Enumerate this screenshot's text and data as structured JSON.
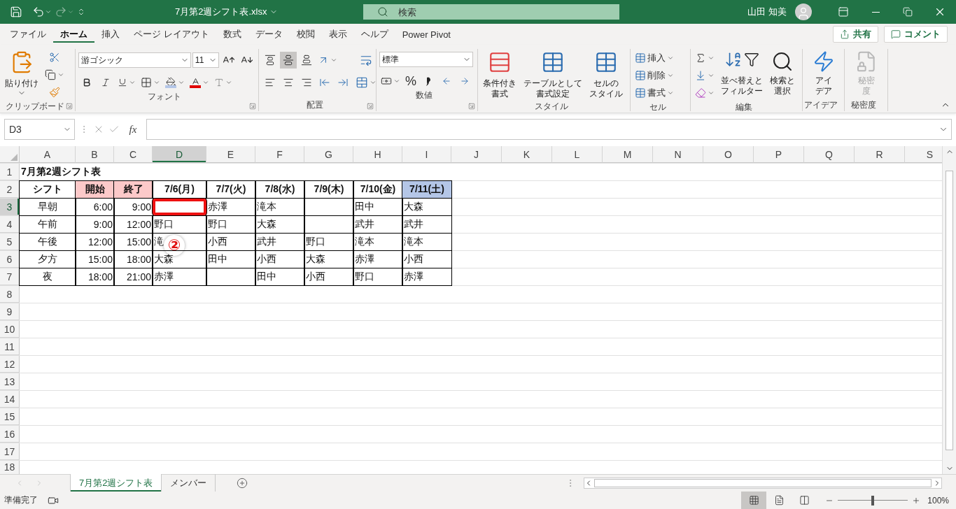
{
  "title_bar": {
    "file_name": "7月第2週シフト表.xlsx",
    "search": {
      "placeholder": "検索"
    },
    "user_name": "山田 知美"
  },
  "menu_tabs": [
    {
      "label": "ファイル",
      "selected": false
    },
    {
      "label": "ホーム",
      "selected": true
    },
    {
      "label": "挿入",
      "selected": false
    },
    {
      "label": "ページ レイアウト",
      "selected": false
    },
    {
      "label": "数式",
      "selected": false
    },
    {
      "label": "データ",
      "selected": false
    },
    {
      "label": "校閲",
      "selected": false
    },
    {
      "label": "表示",
      "selected": false
    },
    {
      "label": "ヘルプ",
      "selected": false
    },
    {
      "label": "Power Pivot",
      "selected": false
    }
  ],
  "share_button": "共有",
  "comment_button": "コメント",
  "ribbon": {
    "groups": [
      {
        "kind": "clipboard",
        "label": "クリップボード",
        "paste": "貼り付け"
      },
      {
        "kind": "font",
        "label": "フォント",
        "font_name": "游ゴシック",
        "font_size": "11"
      },
      {
        "kind": "alignment",
        "label": "配置",
        "vertical_buttons": [
          {
            "selected": false
          },
          {
            "selected": true
          },
          {
            "selected": false
          }
        ]
      },
      {
        "kind": "number",
        "label": "数値",
        "format": "標準",
        "percent": "%"
      },
      {
        "kind": "styles",
        "label": "スタイル",
        "buttons": [
          {
            "lines": [
              "条件付き",
              "書式"
            ]
          },
          {
            "lines": [
              "テーブルとして",
              "書式設定"
            ]
          },
          {
            "lines": [
              "セルの",
              "スタイル"
            ]
          }
        ]
      },
      {
        "kind": "cells",
        "label": "セル",
        "buttons": [
          "挿入",
          "削除",
          "書式"
        ]
      },
      {
        "kind": "editing",
        "label": "編集",
        "buttons": [
          {
            "lines": [
              "並べ替えと",
              "フィルター"
            ]
          },
          {
            "lines": [
              "検索と",
              "選択"
            ]
          }
        ]
      },
      {
        "kind": "ideas",
        "label": "アイデア",
        "button": {
          "lines": [
            "アイ",
            "デア"
          ],
          "disabled": false
        }
      },
      {
        "kind": "sensitivity",
        "label": "秘密度",
        "button": {
          "lines": [
            "秘密",
            "度"
          ],
          "disabled": true
        }
      }
    ]
  },
  "formula_bar": {
    "name_box": "D3",
    "function_label": "fx"
  },
  "sheet": {
    "columns": [
      {
        "label": "A",
        "selected": false
      },
      {
        "label": "B",
        "selected": false
      },
      {
        "label": "C",
        "selected": false
      },
      {
        "label": "D",
        "selected": true
      },
      {
        "label": "E",
        "selected": false
      },
      {
        "label": "F",
        "selected": false
      },
      {
        "label": "G",
        "selected": false
      },
      {
        "label": "H",
        "selected": false
      },
      {
        "label": "I",
        "selected": false
      },
      {
        "label": "J",
        "selected": false
      },
      {
        "label": "K",
        "selected": false
      },
      {
        "label": "L",
        "selected": false
      },
      {
        "label": "M",
        "selected": false
      },
      {
        "label": "N",
        "selected": false
      },
      {
        "label": "O",
        "selected": false
      },
      {
        "label": "P",
        "selected": false
      },
      {
        "label": "Q",
        "selected": false
      },
      {
        "label": "R",
        "selected": false
      },
      {
        "label": "S",
        "selected": false
      }
    ],
    "rows": [
      {
        "number": "1",
        "selected": false,
        "cells": [
          {
            "text": "7月第2週シフト表",
            "kind": "title",
            "bordered": false
          }
        ]
      },
      {
        "number": "2",
        "selected": false,
        "cells": [
          {
            "text": "シフト",
            "kind": "header",
            "bordered": true
          },
          {
            "text": "開始",
            "kind": "header",
            "bordered": true,
            "color": "#fcc9c9"
          },
          {
            "text": "終了",
            "kind": "header",
            "bordered": true,
            "color": "#fcc9c9"
          },
          {
            "text": "7/6(月)",
            "kind": "header",
            "bordered": true
          },
          {
            "text": "7/7(火)",
            "kind": "header",
            "bordered": true
          },
          {
            "text": "7/8(水)",
            "kind": "header",
            "bordered": true
          },
          {
            "text": "7/9(木)",
            "kind": "header",
            "bordered": true
          },
          {
            "text": "7/10(金)",
            "kind": "header",
            "bordered": true
          },
          {
            "text": "7/11(土)",
            "kind": "header",
            "bordered": true,
            "color": "#b4c6e7"
          }
        ]
      },
      {
        "number": "3",
        "selected": true,
        "cells": [
          {
            "text": "早朝",
            "kind": "label",
            "bordered": true
          },
          {
            "text": "6:00",
            "kind": "time",
            "bordered": true
          },
          {
            "text": "9:00",
            "kind": "time",
            "bordered": true
          },
          {
            "kind": "name",
            "bordered": true
          },
          {
            "text": "赤澤",
            "kind": "name",
            "bordered": true
          },
          {
            "text": "滝本",
            "kind": "name",
            "bordered": true
          },
          {
            "kind": "name",
            "bordered": true
          },
          {
            "text": "田中",
            "kind": "name",
            "bordered": true
          },
          {
            "text": "大森",
            "kind": "name",
            "bordered": true
          }
        ]
      },
      {
        "number": "4",
        "selected": false,
        "cells": [
          {
            "text": "午前",
            "kind": "label",
            "bordered": true
          },
          {
            "text": "9:00",
            "kind": "time",
            "bordered": true
          },
          {
            "text": "12:00",
            "kind": "time",
            "bordered": true
          },
          {
            "text": "野口",
            "kind": "name",
            "bordered": true
          },
          {
            "text": "野口",
            "kind": "name",
            "bordered": true
          },
          {
            "text": "大森",
            "kind": "name",
            "bordered": true
          },
          {
            "kind": "name",
            "bordered": true
          },
          {
            "text": "武井",
            "kind": "name",
            "bordered": true
          },
          {
            "text": "武井",
            "kind": "name",
            "bordered": true
          }
        ]
      },
      {
        "number": "5",
        "selected": false,
        "cells": [
          {
            "text": "午後",
            "kind": "label",
            "bordered": true
          },
          {
            "text": "12:00",
            "kind": "time",
            "bordered": true
          },
          {
            "text": "15:00",
            "kind": "time",
            "bordered": true
          },
          {
            "text": "滝",
            "kind": "name",
            "bordered": true,
            "callout": "②"
          },
          {
            "text": "小西",
            "kind": "name",
            "bordered": true
          },
          {
            "text": "武井",
            "kind": "name",
            "bordered": true
          },
          {
            "text": "野口",
            "kind": "name",
            "bordered": true
          },
          {
            "text": "滝本",
            "kind": "name",
            "bordered": true
          },
          {
            "text": "滝本",
            "kind": "name",
            "bordered": true
          }
        ]
      },
      {
        "number": "6",
        "selected": false,
        "cells": [
          {
            "text": "夕方",
            "kind": "label",
            "bordered": true
          },
          {
            "text": "15:00",
            "kind": "time",
            "bordered": true
          },
          {
            "text": "18:00",
            "kind": "time",
            "bordered": true
          },
          {
            "text": "大森",
            "kind": "name",
            "bordered": true
          },
          {
            "text": "田中",
            "kind": "name",
            "bordered": true
          },
          {
            "text": "小西",
            "kind": "name",
            "bordered": true
          },
          {
            "text": "大森",
            "kind": "name",
            "bordered": true
          },
          {
            "text": "赤澤",
            "kind": "name",
            "bordered": true
          },
          {
            "text": "小西",
            "kind": "name",
            "bordered": true
          }
        ]
      },
      {
        "number": "7",
        "selected": false,
        "cells": [
          {
            "text": "夜",
            "kind": "label",
            "bordered": true
          },
          {
            "text": "18:00",
            "kind": "time",
            "bordered": true
          },
          {
            "text": "21:00",
            "kind": "time",
            "bordered": true
          },
          {
            "text": "赤澤",
            "kind": "name",
            "bordered": true
          },
          {
            "kind": "name",
            "bordered": true
          },
          {
            "text": "田中",
            "kind": "name",
            "bordered": true
          },
          {
            "text": "小西",
            "kind": "name",
            "bordered": true
          },
          {
            "text": "野口",
            "kind": "name",
            "bordered": true
          },
          {
            "text": "赤澤",
            "kind": "name",
            "bordered": true
          }
        ]
      },
      {
        "number": "8",
        "selected": false
      },
      {
        "number": "9",
        "selected": false
      },
      {
        "number": "10",
        "selected": false
      },
      {
        "number": "11",
        "selected": false
      },
      {
        "number": "12",
        "selected": false
      },
      {
        "number": "13",
        "selected": false
      },
      {
        "number": "14",
        "selected": false
      },
      {
        "number": "15",
        "selected": false
      },
      {
        "number": "16",
        "selected": false
      },
      {
        "number": "17",
        "selected": false
      },
      {
        "number": "18",
        "selected": false
      }
    ]
  },
  "sheet_tabs": [
    {
      "label": "7月第2週シフト表",
      "selected": true
    },
    {
      "label": "メンバー",
      "selected": false
    }
  ],
  "status_bar": {
    "status": "準備完了",
    "view_buttons": [
      {
        "selected": true
      },
      {
        "selected": false
      },
      {
        "selected": false
      }
    ],
    "zoom": {
      "level": 0.5,
      "reading": "100%"
    }
  }
}
